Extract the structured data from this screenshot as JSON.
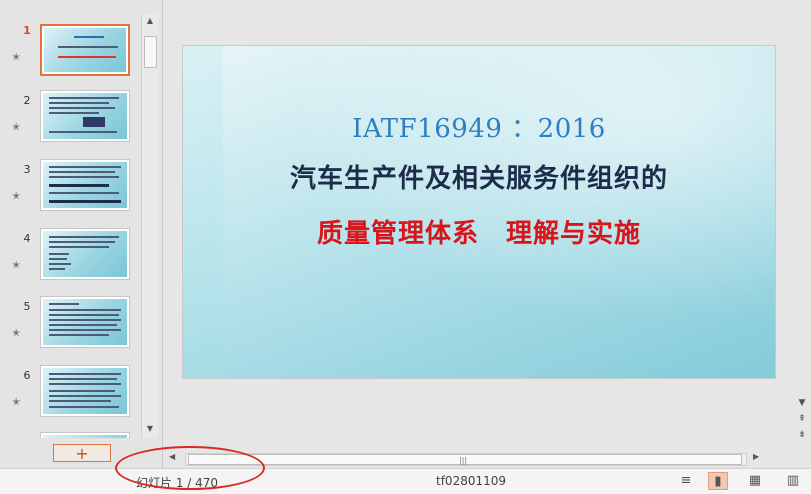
{
  "thumbnails": [
    {
      "number": "1",
      "active": true
    },
    {
      "number": "2",
      "active": false
    },
    {
      "number": "3",
      "active": false
    },
    {
      "number": "4",
      "active": false
    },
    {
      "number": "5",
      "active": false
    },
    {
      "number": "6",
      "active": false
    }
  ],
  "slide": {
    "line1": "IATF16949 ：2016",
    "line2": "汽车生产件及相关服务件组织的",
    "line3": "质量管理体系　理解与实施"
  },
  "new_slide_button": "+",
  "statusbar": {
    "slide_counter": "幻灯片 1 / 470",
    "file_name": "tf02801109"
  },
  "colors": {
    "accent": "#e0733d",
    "annotation": "#d92a20"
  },
  "icons": {
    "star": "star-icon",
    "notes": "notes-icon",
    "normal_view": "normal-view-icon",
    "sorter_view": "slide-sorter-icon",
    "reading_view": "reading-view-icon"
  }
}
